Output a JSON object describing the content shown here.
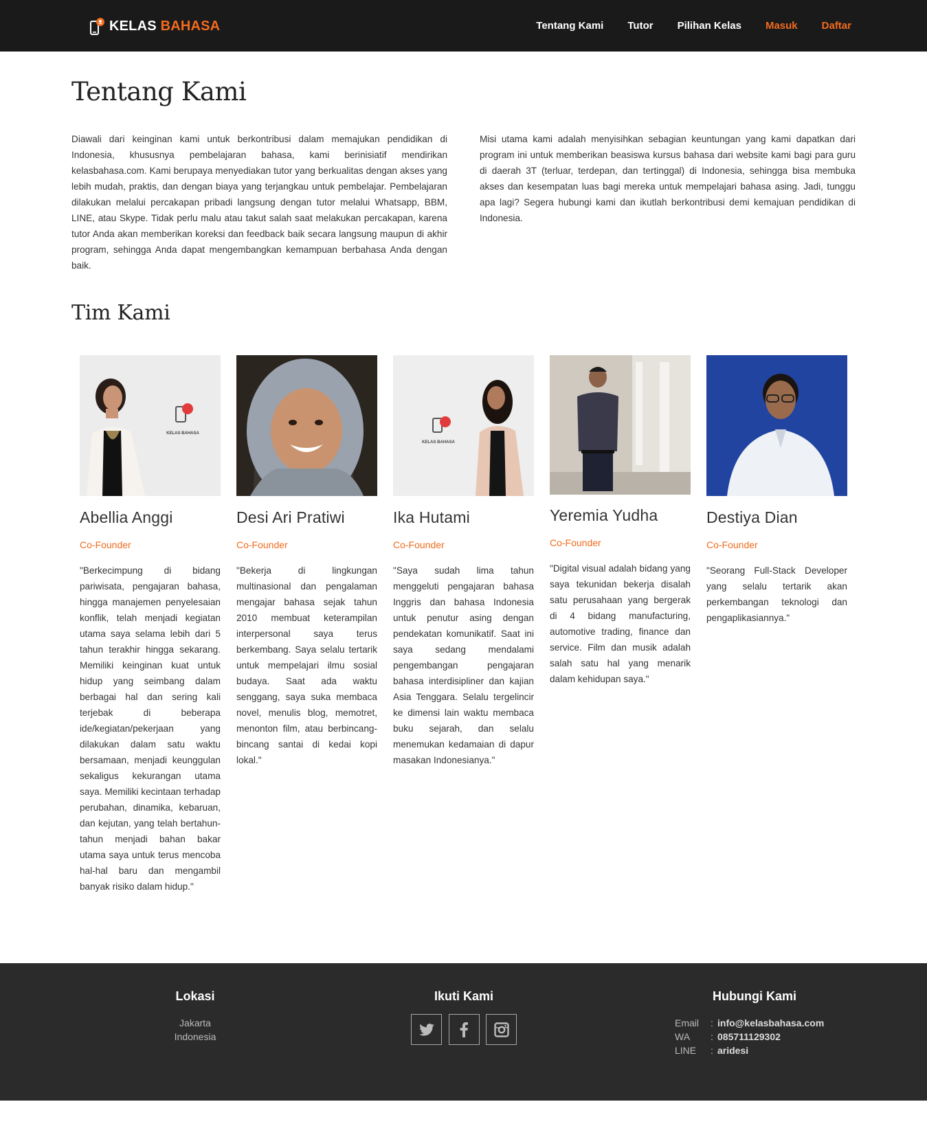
{
  "brand": {
    "name_part1": "KELAS",
    "name_part2": "BAHASA",
    "accent_color": "#f26b1d"
  },
  "nav": {
    "items": [
      {
        "label": "Tentang Kami"
      },
      {
        "label": "Tutor"
      },
      {
        "label": "Pilihan Kelas"
      },
      {
        "label": "Masuk"
      },
      {
        "label": "Daftar"
      }
    ]
  },
  "about": {
    "title": "Tentang Kami",
    "paragraphs": [
      "Diawali dari keinginan kami untuk berkontribusi dalam memajukan pendidikan di Indonesia, khususnya pembelajaran bahasa, kami berinisiatif mendirikan kelasbahasa.com. Kami berupaya menyediakan tutor yang berkualitas dengan akses yang lebih mudah, praktis, dan dengan biaya yang terjangkau untuk pembelajar. Pembelajaran dilakukan melalui percakapan pribadi langsung dengan tutor melalui Whatsapp, BBM, LINE, atau Skype. Tidak perlu malu atau takut salah saat melakukan percakapan, karena tutor Anda akan memberikan koreksi dan feedback baik secara langsung maupun di akhir program, sehingga Anda dapat mengembangkan kemampuan berbahasa Anda dengan baik.",
      "Misi utama kami adalah menyisihkan sebagian keuntungan yang kami dapatkan dari program ini untuk memberikan beasiswa kursus bahasa dari website kami bagi para guru di daerah 3T (terluar, terdepan, dan tertinggal) di Indonesia, sehingga bisa membuka akses dan kesempatan luas bagi mereka untuk mempelajari bahasa asing. Jadi, tunggu apa lagi? Segera hubungi kami dan ikutlah berkontribusi demi kemajuan pendidikan di Indonesia."
    ]
  },
  "team": {
    "title": "Tim Kami",
    "members": [
      {
        "name": "Abellia Anggi",
        "role": "Co-Founder",
        "quote": "\"Berkecimpung di bidang pariwisata, pengajaran bahasa, hingga manajemen penyelesaian konflik, telah menjadi kegiatan utama saya selama lebih dari 5 tahun terakhir hingga sekarang. Memiliki keinginan kuat untuk hidup yang seimbang dalam berbagai hal dan sering kali terjebak di beberapa ide/kegiatan/pekerjaan yang dilakukan dalam satu waktu bersamaan, menjadi keunggulan sekaligus kekurangan utama saya. Memiliki kecintaan terhadap perubahan, dinamika, kebaruan, dan kejutan, yang telah bertahun-tahun menjadi bahan bakar utama saya untuk terus mencoba hal-hal baru dan mengambil banyak risiko dalam hidup.\""
      },
      {
        "name": "Desi Ari Pratiwi",
        "role": "Co-Founder",
        "quote": "\"Bekerja di lingkungan multinasional dan pengalaman mengajar bahasa sejak tahun 2010 membuat keterampilan interpersonal saya terus berkembang. Saya selalu tertarik untuk mempelajari ilmu sosial budaya. Saat ada waktu senggang, saya suka membaca novel, menulis blog, memotret, menonton film, atau berbincang-bincang santai di kedai kopi lokal.\""
      },
      {
        "name": "Ika Hutami",
        "role": "Co-Founder",
        "quote": "\"Saya sudah lima tahun menggeluti pengajaran bahasa Inggris dan bahasa Indonesia untuk penutur asing dengan pendekatan komunikatif. Saat ini saya sedang mendalami pengembangan pengajaran bahasa interdisipliner dan kajian Asia Tenggara. Selalu tergelincir ke dimensi lain waktu membaca buku sejarah, dan selalu menemukan kedamaian di dapur masakan Indonesianya.\""
      },
      {
        "name": "Yeremia Yudha",
        "role": "Co-Founder",
        "quote": "\"Digital visual adalah bidang yang saya tekunidan bekerja disalah satu perusahaan yang bergerak di 4 bidang manufacturing, automotive trading, finance dan service. Film dan musik adalah salah satu hal yang menarik dalam kehidupan saya.\""
      },
      {
        "name": "Destiya Dian",
        "role": "Co-Founder",
        "quote": "\"Seorang Full-Stack Developer yang selalu tertarik akan perkembangan teknologi dan pengaplikasiannya.\""
      }
    ],
    "photo_logo_text": "KELAS BAHASA"
  },
  "footer": {
    "lokasi": {
      "title": "Lokasi",
      "city": "Jakarta",
      "country": "Indonesia"
    },
    "ikuti": {
      "title": "Ikuti Kami",
      "icons": [
        "twitter-icon",
        "facebook-icon",
        "instagram-icon"
      ]
    },
    "hubungi": {
      "title": "Hubungi Kami",
      "rows": [
        {
          "key": "Email",
          "value": "info@kelasbahasa.com"
        },
        {
          "key": "WA",
          "value": "085711129302"
        },
        {
          "key": "LINE",
          "value": "aridesi"
        }
      ]
    }
  }
}
